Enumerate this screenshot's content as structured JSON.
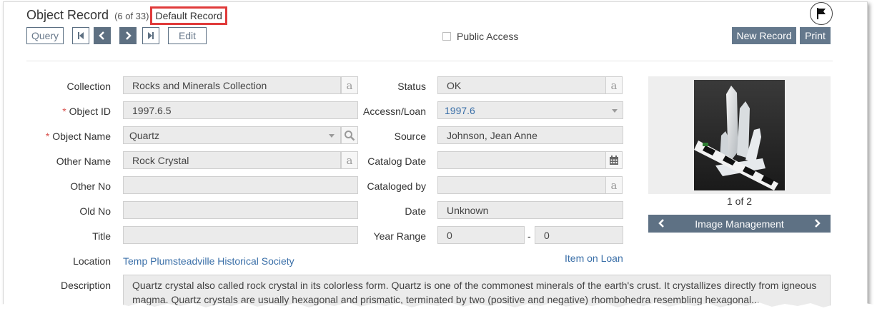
{
  "header": {
    "title": "Object Record",
    "count": "(6 of 33)",
    "default_record": "Default Record"
  },
  "toolbar": {
    "query_label": "Query",
    "edit_label": "Edit",
    "public_access_label": "Public Access",
    "new_record_label": "New Record",
    "print_label": "Print"
  },
  "left_fields": {
    "collection": {
      "label": "Collection",
      "value": "Rocks and Minerals Collection"
    },
    "object_id": {
      "label": "Object ID",
      "value": "1997.6.5"
    },
    "object_name": {
      "label": "Object Name",
      "value": "Quartz"
    },
    "other_name": {
      "label": "Other Name",
      "value": "Rock Crystal"
    },
    "other_no": {
      "label": "Other No",
      "value": ""
    },
    "old_no": {
      "label": "Old No",
      "value": ""
    },
    "title": {
      "label": "Title",
      "value": ""
    },
    "location": {
      "label": "Location",
      "value": "Temp Plumsteadville Historical Society"
    }
  },
  "right_fields": {
    "status": {
      "label": "Status",
      "value": "OK"
    },
    "accessn_loan": {
      "label": "Accessn/Loan",
      "value": "1997.6"
    },
    "source": {
      "label": "Source",
      "value": "Johnson, Jean Anne"
    },
    "catalog_date": {
      "label": "Catalog Date",
      "value": ""
    },
    "cataloged_by": {
      "label": "Cataloged by",
      "value": ""
    },
    "date": {
      "label": "Date",
      "value": "Unknown"
    },
    "year_range": {
      "label": "Year Range",
      "from": "0",
      "separator": "-",
      "to": "0"
    },
    "item_on_loan": "Item on Loan"
  },
  "image": {
    "count": "1 of 2",
    "management_label": "Image Management"
  },
  "description": {
    "label": "Description",
    "value": "Quartz crystal also called rock crystal in its colorless form.  Quartz is one of the commonest minerals of the earth's crust.  It crystallizes directly from igneous magma.  Quartz crystals are usually hexagonal and prismatic, terminated by two (positive and negative) rhombohedra resembling hexagonal..."
  },
  "icons": {
    "flag": "flag-icon",
    "first": "first-record-icon",
    "prev": "prev-record-icon",
    "next": "next-record-icon",
    "last": "last-record-icon",
    "lookup": "a-lookup-icon",
    "search": "search-icon",
    "calendar": "calendar-icon"
  },
  "colors": {
    "accent": "#5e7184",
    "link": "#3a6fa8",
    "required": "#d9534f",
    "highlight_box": "#e03a3a"
  }
}
